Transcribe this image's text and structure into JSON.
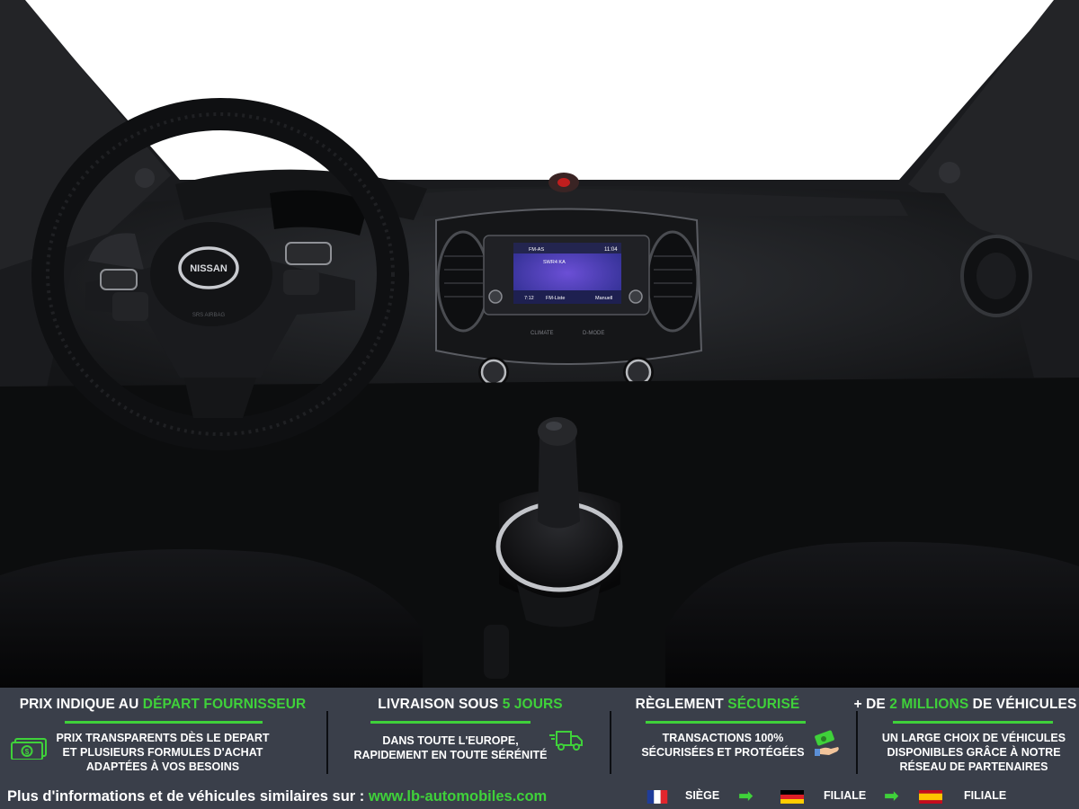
{
  "banner": {
    "features": [
      {
        "title_before": "PRIX INDIQUE AU ",
        "title_highlight": "DÉPART FOURNISSEUR",
        "title_after": "",
        "text": "PRIX TRANSPARENTS DÈS LE DEPART ET PLUSIEURS FORMULES D'ACHAT ADAPTÉES À VOS BESOINS",
        "icon": "money-icon"
      },
      {
        "title_before": "LIVRAISON SOUS ",
        "title_highlight": "5 JOURS",
        "title_after": "",
        "text": "DANS TOUTE L'EUROPE, RAPIDEMENT EN TOUTE SÉRÉNITÉ",
        "icon": "delivery-truck-icon"
      },
      {
        "title_before": "RÈGLEMENT ",
        "title_highlight": "SÉCURISÉ",
        "title_after": "",
        "text": "TRANSACTIONS 100% SÉCURISÉES ET PROTÉGÉES",
        "icon": "payment-hand-icon"
      },
      {
        "title_before": "+ DE ",
        "title_highlight": "2 MILLIONS",
        "title_after": " DE VÉHICULES",
        "text": "UN LARGE CHOIX DE VÉHICULES DISPONIBLES GRÂCE À NOTRE RÉSEAU DE PARTENAIRES",
        "icon": ""
      }
    ],
    "footer_prefix": "Plus d'informations et de véhicules similaires sur : ",
    "footer_url": "www.lb-automobiles.com",
    "locations": [
      {
        "flag": "france-flag-icon",
        "label": "SIÈGE"
      },
      {
        "flag": "germany-flag-icon",
        "label": "FILIALE"
      },
      {
        "flag": "spain-flag-icon",
        "label": "FILIALE"
      }
    ],
    "accent_color": "#3fd13a",
    "background_color": "#3a3f4a"
  },
  "photo": {
    "brand_emblem": "NISSAN",
    "airbag_label": "SRS AIRBAG",
    "screen": {
      "station": "SWR4 KA",
      "band": "FM-AS",
      "clock": "11:04",
      "preset_left": "7:12",
      "button_center": "FM-Liste",
      "button_right": "Manuell"
    },
    "console_labels": [
      "CLIMATE",
      "D-MODE"
    ]
  }
}
